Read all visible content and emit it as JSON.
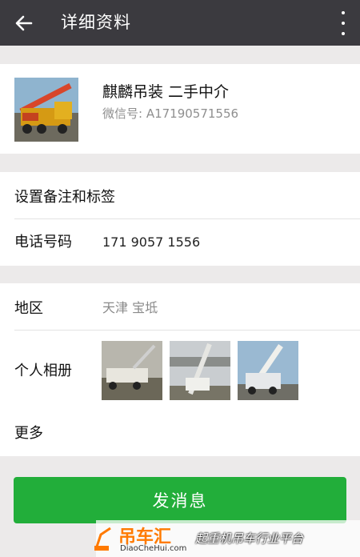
{
  "header": {
    "title": "详细资料",
    "back_icon": "arrow-left-icon",
    "more_icon": "more-vertical-icon"
  },
  "profile": {
    "name": "麒麟吊装   二手中介",
    "wechat_id": "微信号: A17190571556"
  },
  "info": {
    "remark_label": "设置备注和标签",
    "phone_label": "电话号码",
    "phone_value": "171 9057 1556",
    "region_label": "地区",
    "region_value": "天津  宝坻",
    "album_label": "个人相册",
    "more_label": "更多"
  },
  "actions": {
    "send_message": "发消息"
  },
  "watermark": {
    "brand": "吊车汇",
    "url": "DiaoCheHui.com",
    "slogan": "起重机吊车行业平台"
  },
  "colors": {
    "topbar": "#3b3a3f",
    "primary_button": "#22ae3a",
    "background": "#eceaea"
  }
}
